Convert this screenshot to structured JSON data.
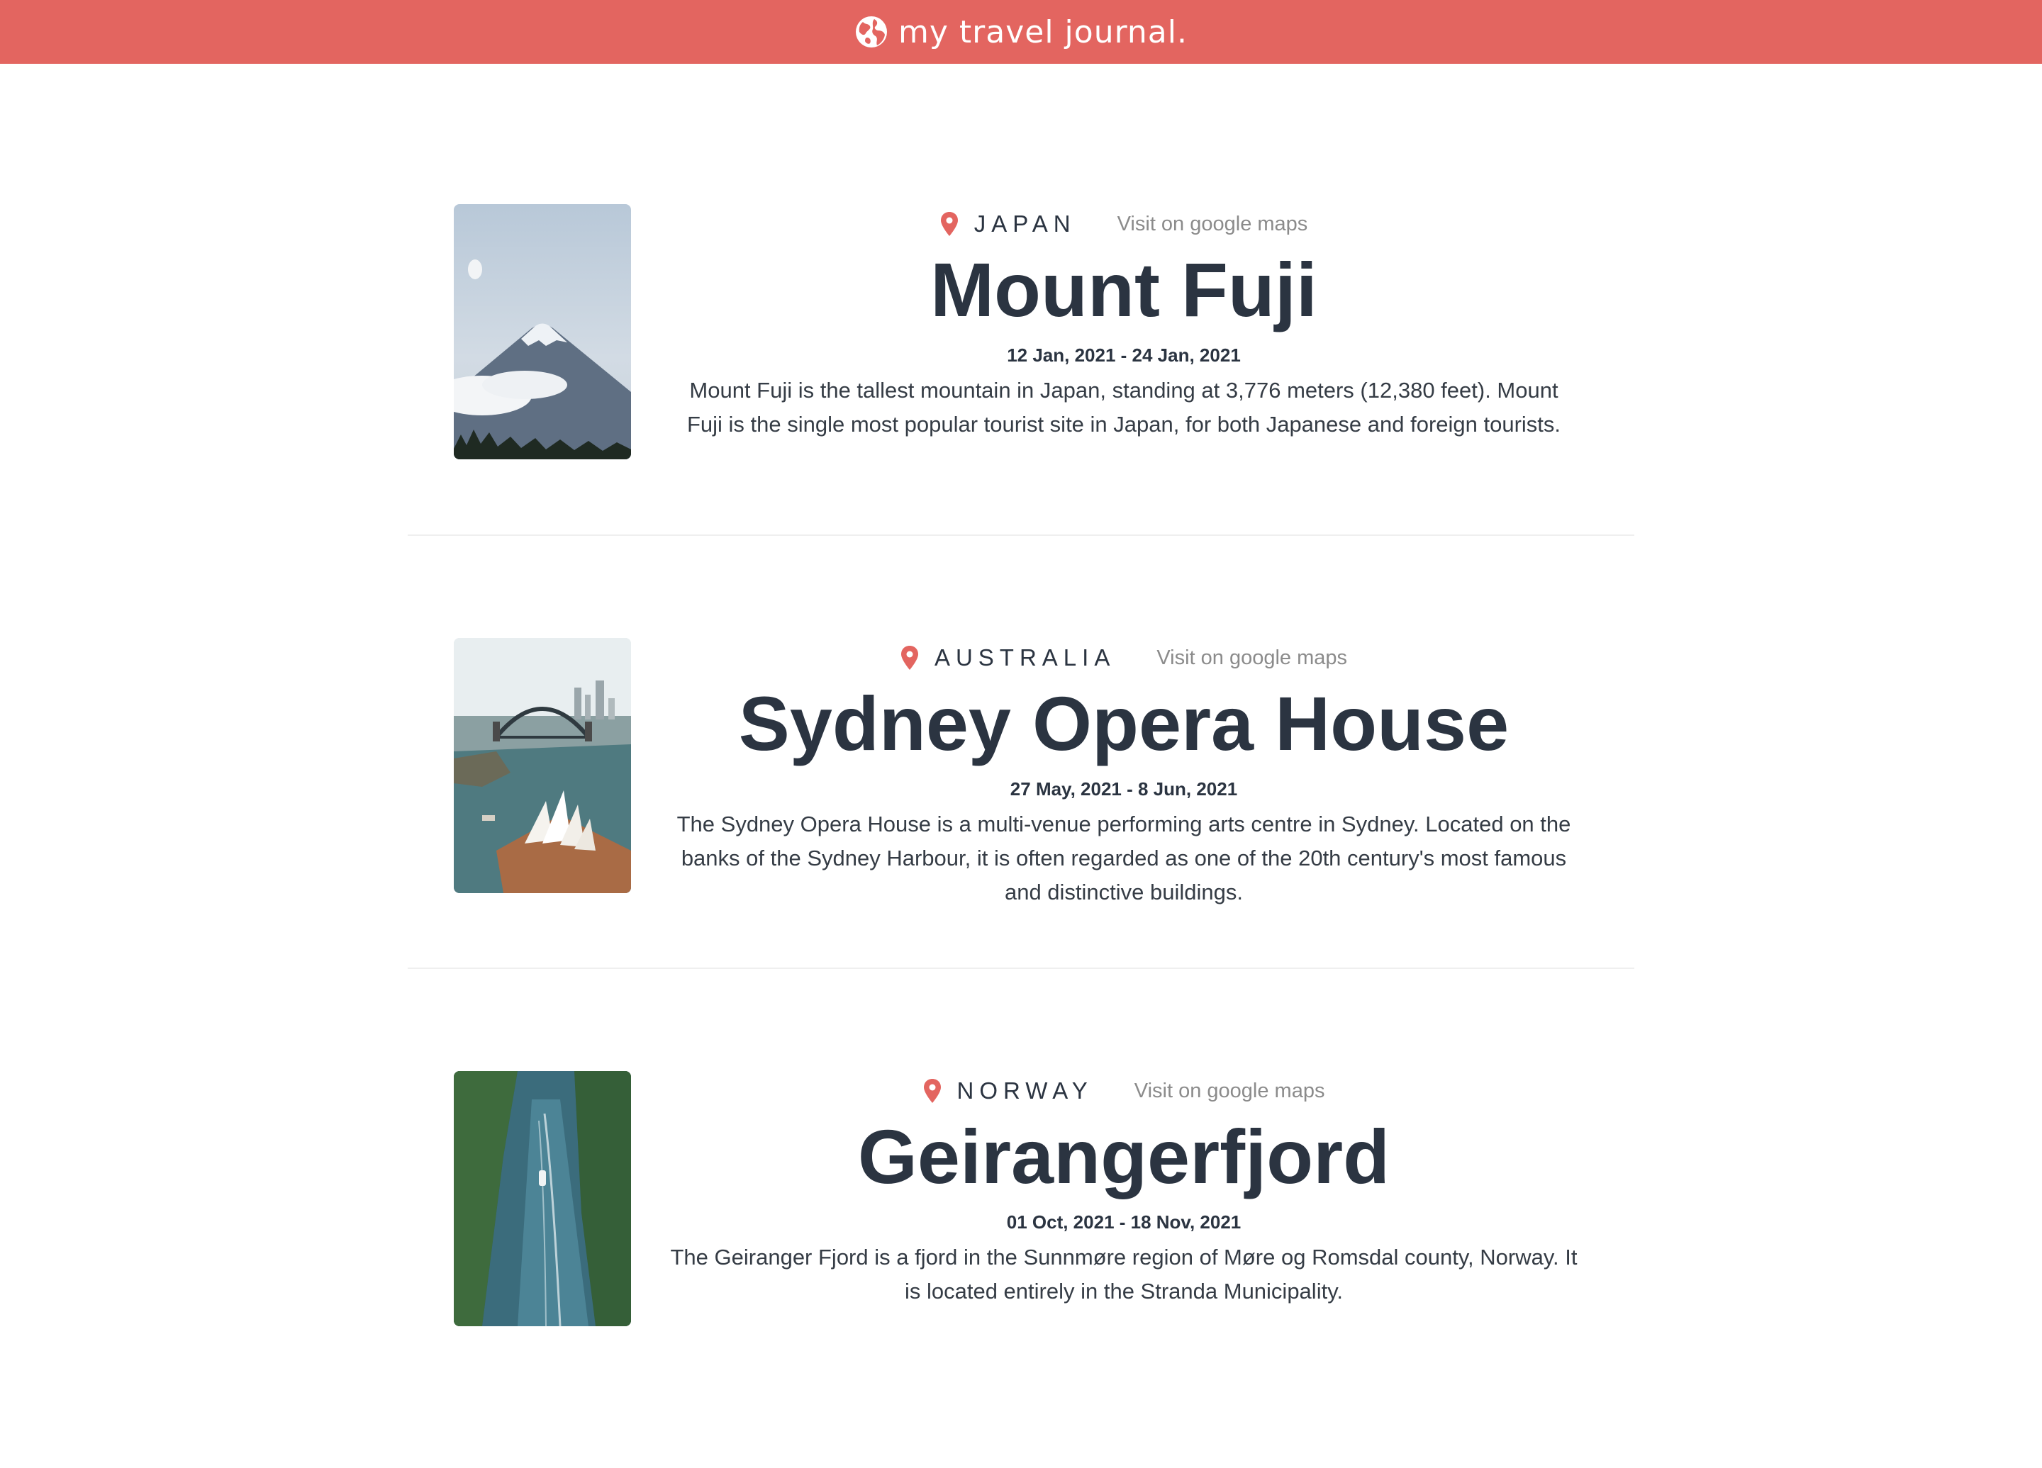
{
  "header": {
    "title": "my travel journal.",
    "icon": "globe-icon",
    "background_color": "#e36560"
  },
  "entries": [
    {
      "country": "JAPAN",
      "map_link_label": "Visit on google maps",
      "place": "Mount Fuji",
      "dates": "12 Jan, 2021 - 24 Jan, 2021",
      "description": "Mount Fuji is the tallest mountain in Japan, standing at 3,776 meters (12,380 feet). Mount Fuji is the single most popular tourist site in Japan, for both Japanese and foreign tourists.",
      "image": "mountain-photo"
    },
    {
      "country": "AUSTRALIA",
      "map_link_label": "Visit on google maps",
      "place": "Sydney Opera House",
      "dates": "27 May, 2021 - 8 Jun, 2021",
      "description": "The Sydney Opera House is a multi-venue performing arts centre in Sydney. Located on the banks of the Sydney Harbour, it is often regarded as one of the 20th century's most famous and distinctive buildings.",
      "image": "opera-house-photo"
    },
    {
      "country": "NORWAY",
      "map_link_label": "Visit on google maps",
      "place": "Geirangerfjord",
      "dates": "01 Oct, 2021 - 18 Nov, 2021",
      "description": "The Geiranger Fjord is a fjord in the Sunnmøre region of Møre og Romsdal county, Norway. It is located entirely in the Stranda Municipality.",
      "image": "fjord-photo"
    }
  ],
  "colors": {
    "accent": "#e36560",
    "heading": "#2b3441",
    "muted": "#8b8b8b"
  }
}
